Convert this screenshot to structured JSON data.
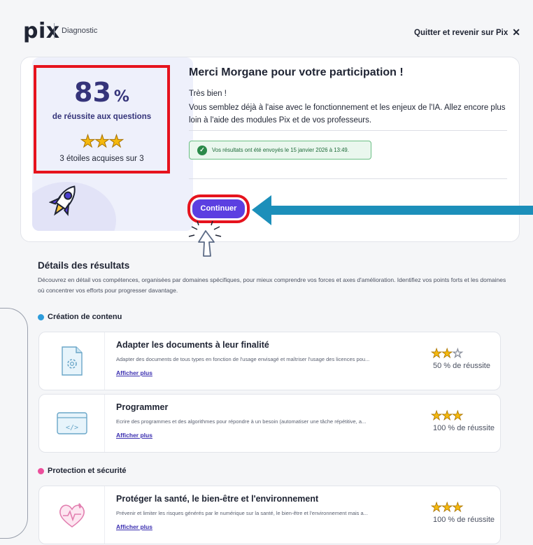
{
  "header": {
    "logo": "pix",
    "breadcrumb": "Diagnostic",
    "quit_label": "Quitter et revenir sur Pix"
  },
  "result": {
    "score_number": "83",
    "score_suffix": "%",
    "score_label": "de réussite aux questions",
    "stars": "★★★",
    "stars_label": "3 étoiles acquises sur 3",
    "thanks": "Merci Morgane pour votre participation !",
    "verdict": "Très bien !",
    "message": "Vous semblez déjà à l'aise avec le fonctionnement et les enjeux de l'IA. Allez encore plus loin à l'aide des modules Pix et de vos professeurs.",
    "notice": "Vos résultats ont été envoyés le 15 janvier 2026 à 13:49.",
    "continue_label": "Continuer"
  },
  "details": {
    "title": "Détails des résultats",
    "description": "Découvrez en détail vos compétences, organisées par domaines spécifiques, pour mieux comprendre vos forces et axes d'amélioration. Identifiez vos points forts et les domaines où concentrer vos efforts pour progresser davantage."
  },
  "domains": [
    {
      "name": "Création de contenu",
      "color": "#2d9cdb",
      "competences": [
        {
          "title": "Adapter les documents à leur finalité",
          "description": "Adapter des documents de tous types en fonction de l'usage envisagé et maîtriser l'usage des licences pou...",
          "more": "Afficher plus",
          "stars_on": "★★",
          "stars_off": "☆",
          "progress": "50 % de réussite"
        },
        {
          "title": "Programmer",
          "description": "Ecrire des programmes et des algorithmes pour répondre à un besoin (automatiser une tâche répétitive, a...",
          "more": "Afficher plus",
          "stars_on": "★★★",
          "stars_off": "",
          "progress": "100 % de réussite"
        }
      ]
    },
    {
      "name": "Protection et sécurité",
      "color": "#ec4f9c",
      "competences": [
        {
          "title": "Protéger la santé, le bien-être et l'environnement",
          "description": "Prévenir et limiter les risques générés par le numérique sur la santé, le bien-être et l'environnement mais a...",
          "more": "Afficher plus",
          "stars_on": "★★★",
          "stars_off": "",
          "progress": "100 % de réussite"
        }
      ]
    }
  ],
  "colors": {
    "accent": "#5b3fe1",
    "highlight": "#e6131d",
    "annotation_arrow": "#1c8fba",
    "score_text": "#35347a",
    "star": "#f5b90e"
  }
}
